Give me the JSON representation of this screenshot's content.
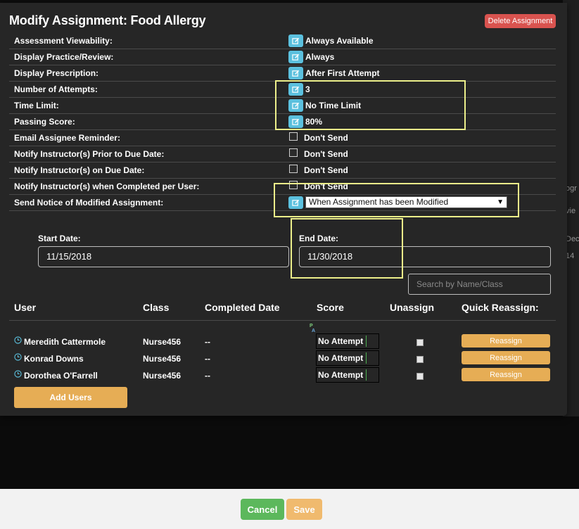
{
  "modal": {
    "title": "Modify Assignment: Food Allergy",
    "delete_label": "Delete Assignment"
  },
  "settings": [
    {
      "label": "Assessment Viewability:",
      "value": "Always Available",
      "control": "edit"
    },
    {
      "label": "Display Practice/Review:",
      "value": "Always",
      "control": "edit"
    },
    {
      "label": "Display Prescription:",
      "value": "After First Attempt",
      "control": "edit"
    },
    {
      "label": "Number of Attempts:",
      "value": "3",
      "control": "edit"
    },
    {
      "label": "Time Limit:",
      "value": "No Time Limit",
      "control": "edit"
    },
    {
      "label": "Passing Score:",
      "value": "80%",
      "control": "edit"
    },
    {
      "label": "Email Assignee Reminder:",
      "value": "Don't Send",
      "control": "checkbox"
    },
    {
      "label": "Notify Instructor(s) Prior to Due Date:",
      "value": "Don't Send",
      "control": "checkbox"
    },
    {
      "label": "Notify Instructor(s) on Due Date:",
      "value": "Don't Send",
      "control": "checkbox"
    },
    {
      "label": "Notify Instructor(s) when Completed per User:",
      "value": "Don't Send",
      "control": "checkbox"
    },
    {
      "label": "Send Notice of Modified Assignment:",
      "value": "When Assignment has been Modified",
      "control": "select"
    }
  ],
  "dates": {
    "start_label": "Start Date:",
    "start_value": "11/15/2018",
    "end_label": "End Date:",
    "end_value": "11/30/2018"
  },
  "search": {
    "placeholder": "Search by Name/Class"
  },
  "users_table": {
    "headers": [
      "User",
      "Class",
      "Completed Date",
      "Score",
      "Unassign",
      "Quick Reassign:"
    ],
    "score_marker_top": "P",
    "score_marker_bottom": "A",
    "rows": [
      {
        "name": "Meredith Cattermole",
        "class": "Nurse456",
        "completed": "--",
        "score": "No Attempt",
        "reassign": "Reassign"
      },
      {
        "name": "Konrad Downs",
        "class": "Nurse456",
        "completed": "--",
        "score": "No Attempt",
        "reassign": "Reassign"
      },
      {
        "name": "Dorothea O'Farrell",
        "class": "Nurse456",
        "completed": "--",
        "score": "No Attempt",
        "reassign": "Reassign"
      }
    ],
    "add_users_label": "Add Users"
  },
  "background_fragments": [
    "ogr",
    "vie",
    "Dec",
    "14"
  ],
  "footer": {
    "cancel_label": "Cancel",
    "save_label": "Save"
  },
  "colors": {
    "modal_bg": "#262626",
    "edit_icon": "#5bc0de",
    "delete": "#d9534f",
    "reassign": "#e6ad55",
    "cancel": "#5cb85c",
    "save": "#f0ad4e",
    "highlight": "#ecef8a"
  }
}
